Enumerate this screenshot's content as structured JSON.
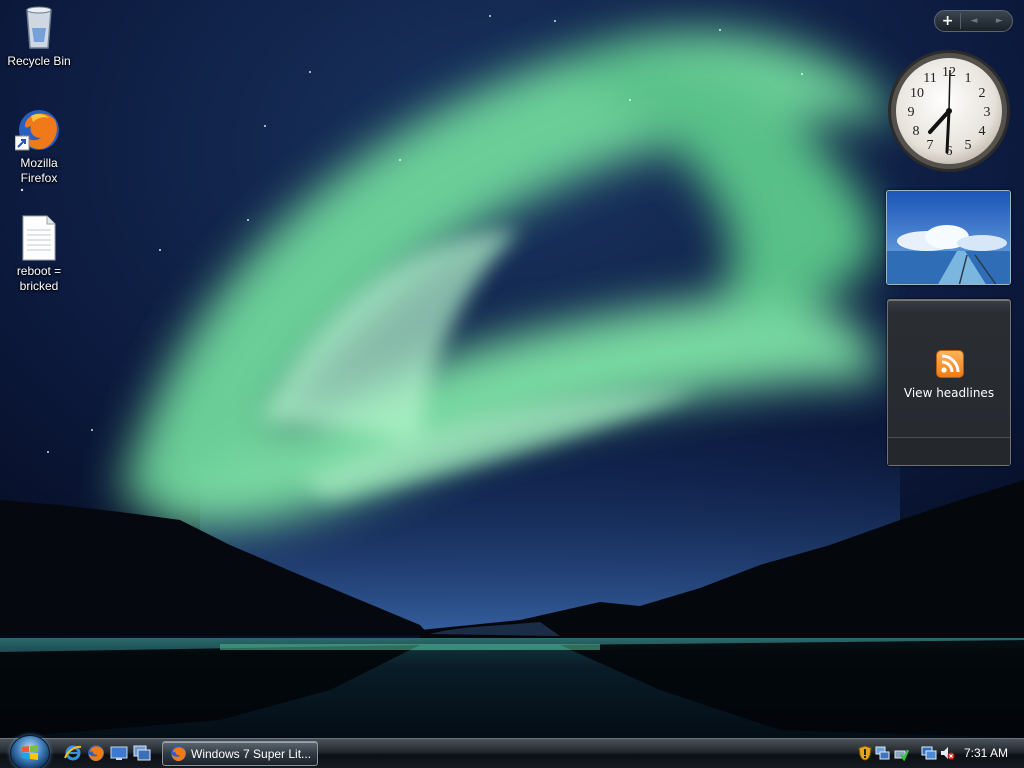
{
  "desktop": {
    "icons": [
      {
        "label": "Recycle Bin",
        "icon": "recycle-bin-icon"
      },
      {
        "label": "Mozilla Firefox",
        "icon": "firefox-icon"
      },
      {
        "label": "reboot = bricked",
        "icon": "text-file-icon"
      }
    ]
  },
  "sidebar": {
    "controls": {
      "add": "+",
      "prev": "◄",
      "next": "►"
    },
    "clock": {
      "numerals": [
        "12",
        "1",
        "2",
        "3",
        "4",
        "5",
        "6",
        "7",
        "8",
        "9",
        "10",
        "11"
      ]
    },
    "feed": {
      "label": "View headlines",
      "icon": "rss-feed-icon"
    }
  },
  "taskbar": {
    "start": "start-orb",
    "quick_launch": [
      "internet-explorer-icon",
      "firefox-icon",
      "show-desktop-icon",
      "switch-windows-icon"
    ],
    "tasks": [
      {
        "label": "Windows 7 Super Lit...",
        "icon": "firefox-icon"
      }
    ],
    "tray": {
      "icons": [
        "security-alert-icon",
        "network-icon",
        "safely-remove-icon",
        "network-connection-icon",
        "volume-muted-icon"
      ],
      "time": "7:31 AM"
    }
  },
  "colors": {
    "aurora": "#7ee0a8",
    "sky": "#0b1840",
    "taskbar": "#1b2229"
  }
}
